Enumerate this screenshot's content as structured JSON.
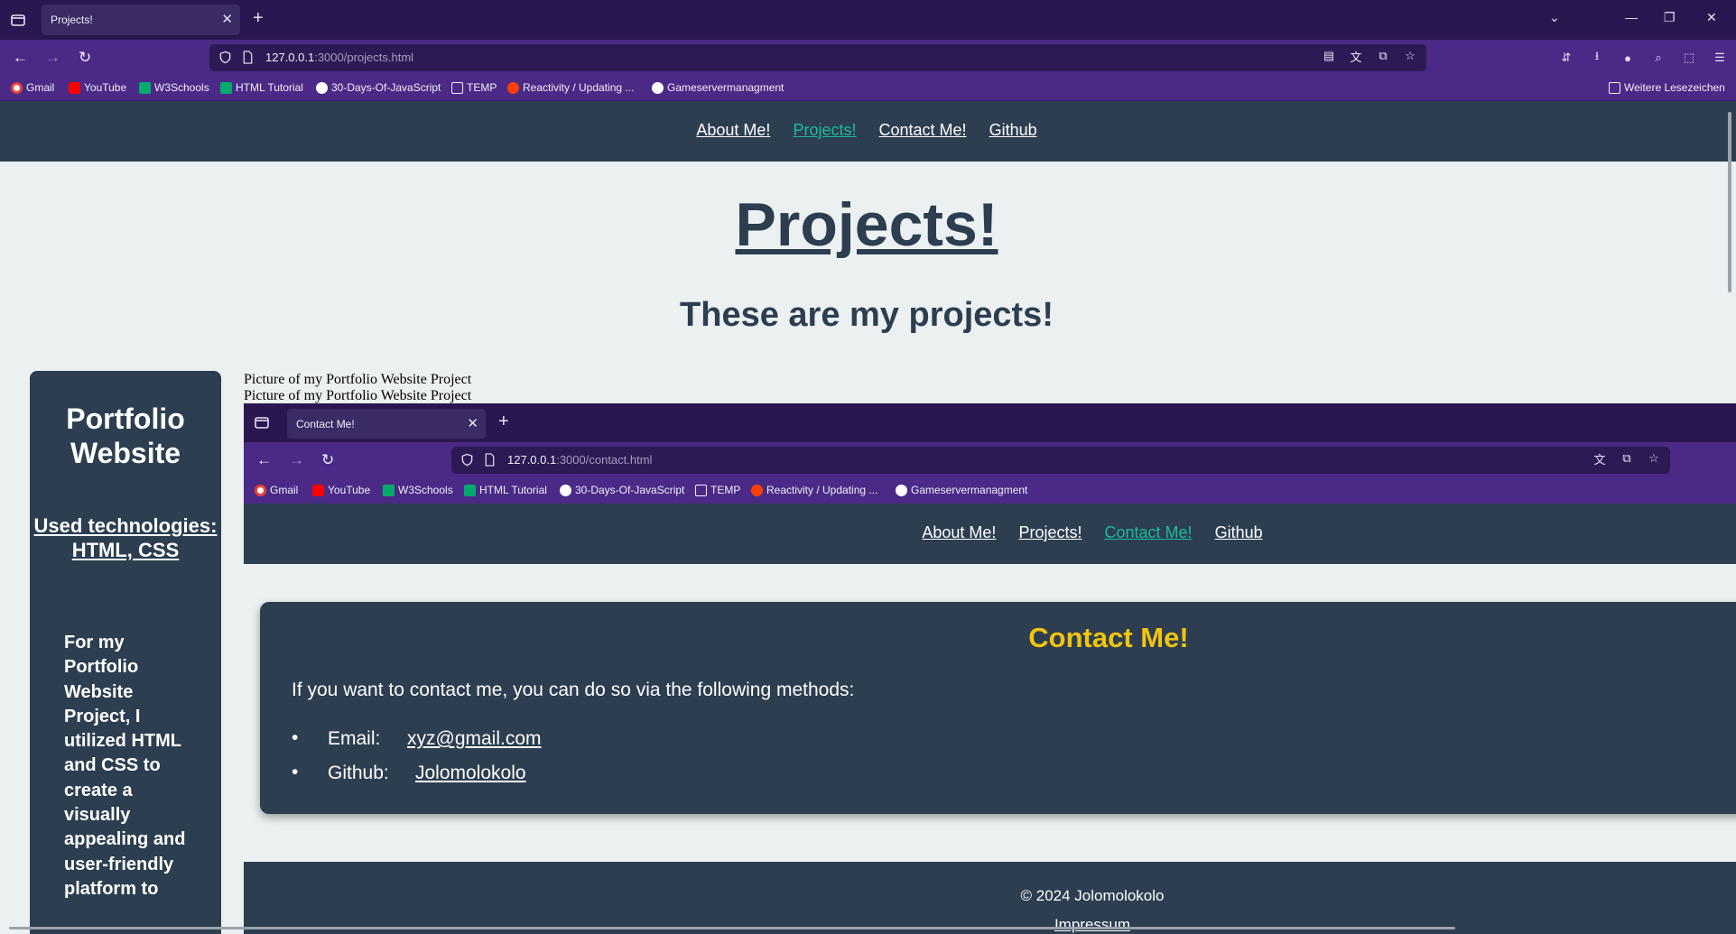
{
  "browser": {
    "tab_title": "Projects!",
    "url_host": "127.0.0.1",
    "url_path": ":3000/projects.html",
    "bookmarks": [
      "Gmail",
      "YouTube",
      "W3Schools",
      "HTML Tutorial",
      "30-Days-Of-JavaScript",
      "TEMP",
      "Reactivity / Updating ...",
      "Gameservermanagment"
    ],
    "other_bookmarks": "Weitere Lesezeichen",
    "accent": "#4a2a86"
  },
  "site": {
    "nav": [
      "About Me!",
      "Projects!",
      "Contact Me!",
      "Github"
    ],
    "title": "Projects!",
    "subtitle": "These are my projects!",
    "project": {
      "title": "Portfolio Website",
      "tech": "Used technologies: HTML, CSS",
      "description": "For my Portfolio Website Project, I utilized HTML and CSS to create a visually appealing and user-friendly platform to"
    },
    "image_alt_1": "Picture of my Portfolio Website Project",
    "image_alt_2": "Picture of my Portfolio Website Project",
    "colors": {
      "header": "#2c3e50",
      "active_link": "#1abc9c",
      "background": "#ecf0f1"
    }
  },
  "embedded": {
    "tab_title": "Contact Me!",
    "url_host": "127.0.0.1",
    "url_path": ":3000/contact.html",
    "bookmarks": [
      "Gmail",
      "YouTube",
      "W3Schools",
      "HTML Tutorial",
      "30-Days-Of-JavaScript",
      "TEMP",
      "Reactivity / Updating ...",
      "Gameservermanagment"
    ],
    "nav": [
      "About Me!",
      "Projects!",
      "Contact Me!",
      "Github"
    ],
    "contact_title": "Contact Me!",
    "contact_intro": "If you want to contact me, you can do so via the following methods:",
    "email_label": "Email:",
    "email_value": "xyz@gmail.com",
    "github_label": "Github:",
    "github_value": "Jolomolokolo",
    "footer_copy": "© 2024 Jolomolokolo",
    "footer_link": "Impressum",
    "title_color": "#f1c40f"
  }
}
